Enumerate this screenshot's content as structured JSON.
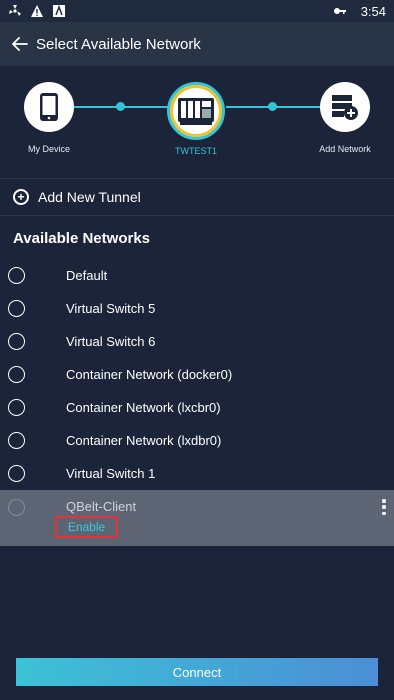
{
  "status_bar": {
    "time": "3:54",
    "icons": [
      "fan-icon",
      "warning-icon",
      "app-notification-icon",
      "key-icon",
      "signal-icon",
      "battery-icon"
    ]
  },
  "app_bar": {
    "title": "Select Available Network",
    "back_icon": "arrow-left-icon"
  },
  "flow": {
    "nodes": [
      {
        "label": "My Device",
        "icon": "phone-icon"
      },
      {
        "label": "TWTEST1",
        "icon": "nas-icon"
      },
      {
        "label": "Add Network",
        "icon": "server-add-icon"
      }
    ],
    "active_color": "#35c4d6"
  },
  "add_tunnel": {
    "label": "Add New Tunnel"
  },
  "section_title": "Available Networks",
  "networks": [
    {
      "name": "Default"
    },
    {
      "name": "Virtual Switch 5"
    },
    {
      "name": "Virtual Switch 6"
    },
    {
      "name": "Container Network (docker0)"
    },
    {
      "name": "Container Network (lxcbr0)"
    },
    {
      "name": "Container Network (lxdbr0)"
    },
    {
      "name": "Virtual Switch 1"
    }
  ],
  "selected_network": {
    "name": "QBelt-Client",
    "action_label": "Enable"
  },
  "connect_button": {
    "label": "Connect"
  },
  "colors": {
    "background": "#1b2438",
    "app_bar": "#2a3447",
    "accent": "#35c4d6",
    "highlight_border": "#e0333a"
  }
}
